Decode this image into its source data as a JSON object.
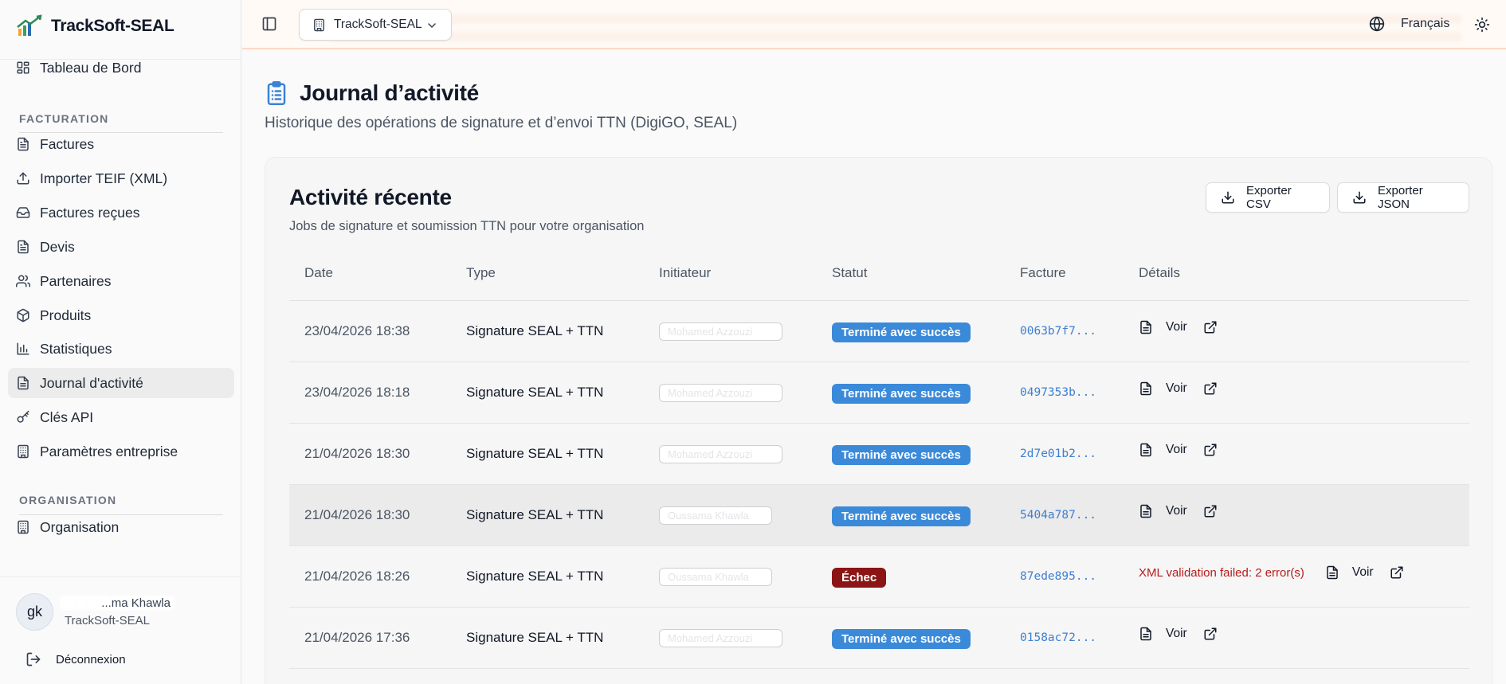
{
  "app": {
    "name": "TrackSoft-SEAL"
  },
  "sidebar": {
    "items_top": [
      {
        "label": "Tableau de Bord",
        "icon": "dashboard-icon"
      }
    ],
    "section_facturation": "FACTURATION",
    "items_facturation": [
      {
        "label": "Factures",
        "icon": "file-text-icon"
      },
      {
        "label": "Importer TEIF (XML)",
        "icon": "upload-icon"
      },
      {
        "label": "Factures reçues",
        "icon": "inbox-icon"
      },
      {
        "label": "Devis",
        "icon": "file-text-icon"
      },
      {
        "label": "Partenaires",
        "icon": "users-icon"
      },
      {
        "label": "Produits",
        "icon": "package-icon"
      },
      {
        "label": "Statistiques",
        "icon": "bar-chart-icon"
      },
      {
        "label": "Journal d'activité",
        "icon": "list-icon",
        "active": true
      },
      {
        "label": "Clés API",
        "icon": "key-icon"
      },
      {
        "label": "Paramètres entreprise",
        "icon": "building-icon"
      }
    ],
    "section_organisation": "ORGANISATION",
    "items_organisation": [
      {
        "label": "Organisation",
        "icon": "building-icon"
      }
    ],
    "user": {
      "initials": "gk",
      "name_visible": "...ma Khawla",
      "org": "TrackSoft-SEAL"
    },
    "logout_label": "Déconnexion"
  },
  "topbar": {
    "org_selector": "TrackSoft-SEAL",
    "language": "Français"
  },
  "page": {
    "title": "Journal d’activité",
    "subtitle": "Historique des opérations de signature et d’envoi TTN (DigiGO, SEAL)"
  },
  "card": {
    "title": "Activité récente",
    "subtitle": "Jobs de signature et soumission TTN pour votre organisation",
    "export_csv": "Exporter CSV",
    "export_json": "Exporter JSON"
  },
  "table": {
    "columns": [
      "Date",
      "Type",
      "Initiateur",
      "Statut",
      "Facture",
      "Détails"
    ],
    "rows": [
      {
        "date": "23/04/2026 18:38",
        "type": "Signature SEAL + TTN",
        "initiator": "Mohamed Azzouzi",
        "status": "Terminé avec succès",
        "status_kind": "ok",
        "invoice": "0063b7f7...",
        "details_error": "",
        "action": "Voir"
      },
      {
        "date": "23/04/2026 18:18",
        "type": "Signature SEAL + TTN",
        "initiator": "Mohamed Azzouzi",
        "status": "Terminé avec succès",
        "status_kind": "ok",
        "invoice": "0497353b...",
        "details_error": "",
        "action": "Voir"
      },
      {
        "date": "21/04/2026 18:30",
        "type": "Signature SEAL + TTN",
        "initiator": "Mohamed Azzouzi",
        "status": "Terminé avec succès",
        "status_kind": "ok",
        "invoice": "2d7e01b2...",
        "details_error": "",
        "action": "Voir"
      },
      {
        "date": "21/04/2026 18:30",
        "type": "Signature SEAL + TTN",
        "initiator": "Oussama Khawla",
        "status": "Terminé avec succès",
        "status_kind": "ok",
        "invoice": "5404a787...",
        "details_error": "",
        "action": "Voir",
        "highlight": true
      },
      {
        "date": "21/04/2026 18:26",
        "type": "Signature SEAL + TTN",
        "initiator": "Oussama Khawla",
        "status": "Échec",
        "status_kind": "fail",
        "invoice": "87ede895...",
        "details_error": "XML validation failed: 2 error(s)",
        "action": "Voir"
      },
      {
        "date": "21/04/2026 17:36",
        "type": "Signature SEAL + TTN",
        "initiator": "Mohamed Azzouzi",
        "status": "Terminé avec succès",
        "status_kind": "ok",
        "invoice": "0158ac72...",
        "details_error": "",
        "action": "Voir"
      }
    ]
  },
  "colors": {
    "accent": "#3b8ad9",
    "success_badge": "#3b8ad9",
    "fail_badge": "#8b1414",
    "link": "#3d7fd1",
    "error_text": "#b71c1c"
  }
}
